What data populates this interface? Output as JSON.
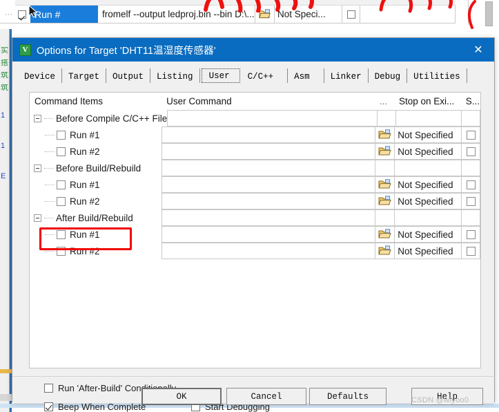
{
  "background": {
    "selected_row_label": "Run #",
    "user_command": "fromelf --output ledproj.bin --bin D:\\...",
    "not_specified": "Not Speci...",
    "dots": "...",
    "left_strip_chars": [
      "实",
      "搭",
      "筑",
      "筑",
      "1",
      "1",
      "E"
    ]
  },
  "dialog": {
    "title": "Options for Target 'DHT11温湿度传感器'",
    "title_icon": "keil-uvision-icon",
    "close_icon": "close-icon",
    "tabs": [
      {
        "label": "Device",
        "selected": false
      },
      {
        "label": "Target",
        "selected": false
      },
      {
        "label": "Output",
        "selected": false
      },
      {
        "label": "Listing",
        "selected": false
      },
      {
        "label": "User",
        "selected": true
      },
      {
        "label": "C/C++",
        "selected": false
      },
      {
        "label": "Asm",
        "selected": false
      },
      {
        "label": "Linker",
        "selected": false
      },
      {
        "label": "Debug",
        "selected": false
      },
      {
        "label": "Utilities",
        "selected": false
      }
    ],
    "table": {
      "headers": {
        "command_items": "Command Items",
        "user_command": "User Command",
        "browse": "...",
        "stop_on_exit": "Stop on Exi...",
        "skip": "S..."
      },
      "rows": [
        {
          "type": "group",
          "label": "Before Compile C/C++ File",
          "expanded": true,
          "command": "",
          "folder": false,
          "stop_on_exit": "",
          "checked": false
        },
        {
          "type": "leaf",
          "label": "Run #1",
          "checked": false,
          "command": "",
          "folder": true,
          "stop_on_exit": "Not Specified",
          "skip": false
        },
        {
          "type": "leaf",
          "label": "Run #2",
          "checked": false,
          "command": "",
          "folder": true,
          "stop_on_exit": "Not Specified",
          "skip": false
        },
        {
          "type": "group",
          "label": "Before Build/Rebuild",
          "expanded": true,
          "command": "",
          "folder": false,
          "stop_on_exit": "",
          "checked": false
        },
        {
          "type": "leaf",
          "label": "Run #1",
          "checked": false,
          "command": "",
          "folder": true,
          "stop_on_exit": "Not Specified",
          "skip": false
        },
        {
          "type": "leaf",
          "label": "Run #2",
          "checked": false,
          "command": "",
          "folder": true,
          "stop_on_exit": "Not Specified",
          "skip": false
        },
        {
          "type": "group",
          "label": "After Build/Rebuild",
          "expanded": true,
          "command": "",
          "folder": false,
          "stop_on_exit": "",
          "checked": false
        },
        {
          "type": "leaf",
          "label": "Run #1",
          "checked": false,
          "highlighted": true,
          "command": "",
          "folder": true,
          "stop_on_exit": "Not Specified",
          "skip": false
        },
        {
          "type": "leaf",
          "label": "Run #2",
          "checked": false,
          "command": "",
          "folder": true,
          "stop_on_exit": "Not Specified",
          "skip": false
        }
      ]
    },
    "options": {
      "run_after_build_conditionally": {
        "label": "Run 'After-Build' Conditionally",
        "checked": false
      },
      "beep_when_complete": {
        "label": "Beep When Complete",
        "checked": true
      },
      "start_debugging": {
        "label": "Start Debugging",
        "checked": false
      }
    },
    "buttons": {
      "ok": "OK",
      "cancel": "Cancel",
      "defaults": "Defaults",
      "help": "Help"
    }
  },
  "watermark": "CSDN @wiyoo0",
  "colors": {
    "titlebar": "#0a6cc0",
    "selection": "#1a7ddb",
    "annotation_red": "#ef0000",
    "dialog_bg": "#f0f0f0",
    "folder_icon": "#e8b44a"
  }
}
